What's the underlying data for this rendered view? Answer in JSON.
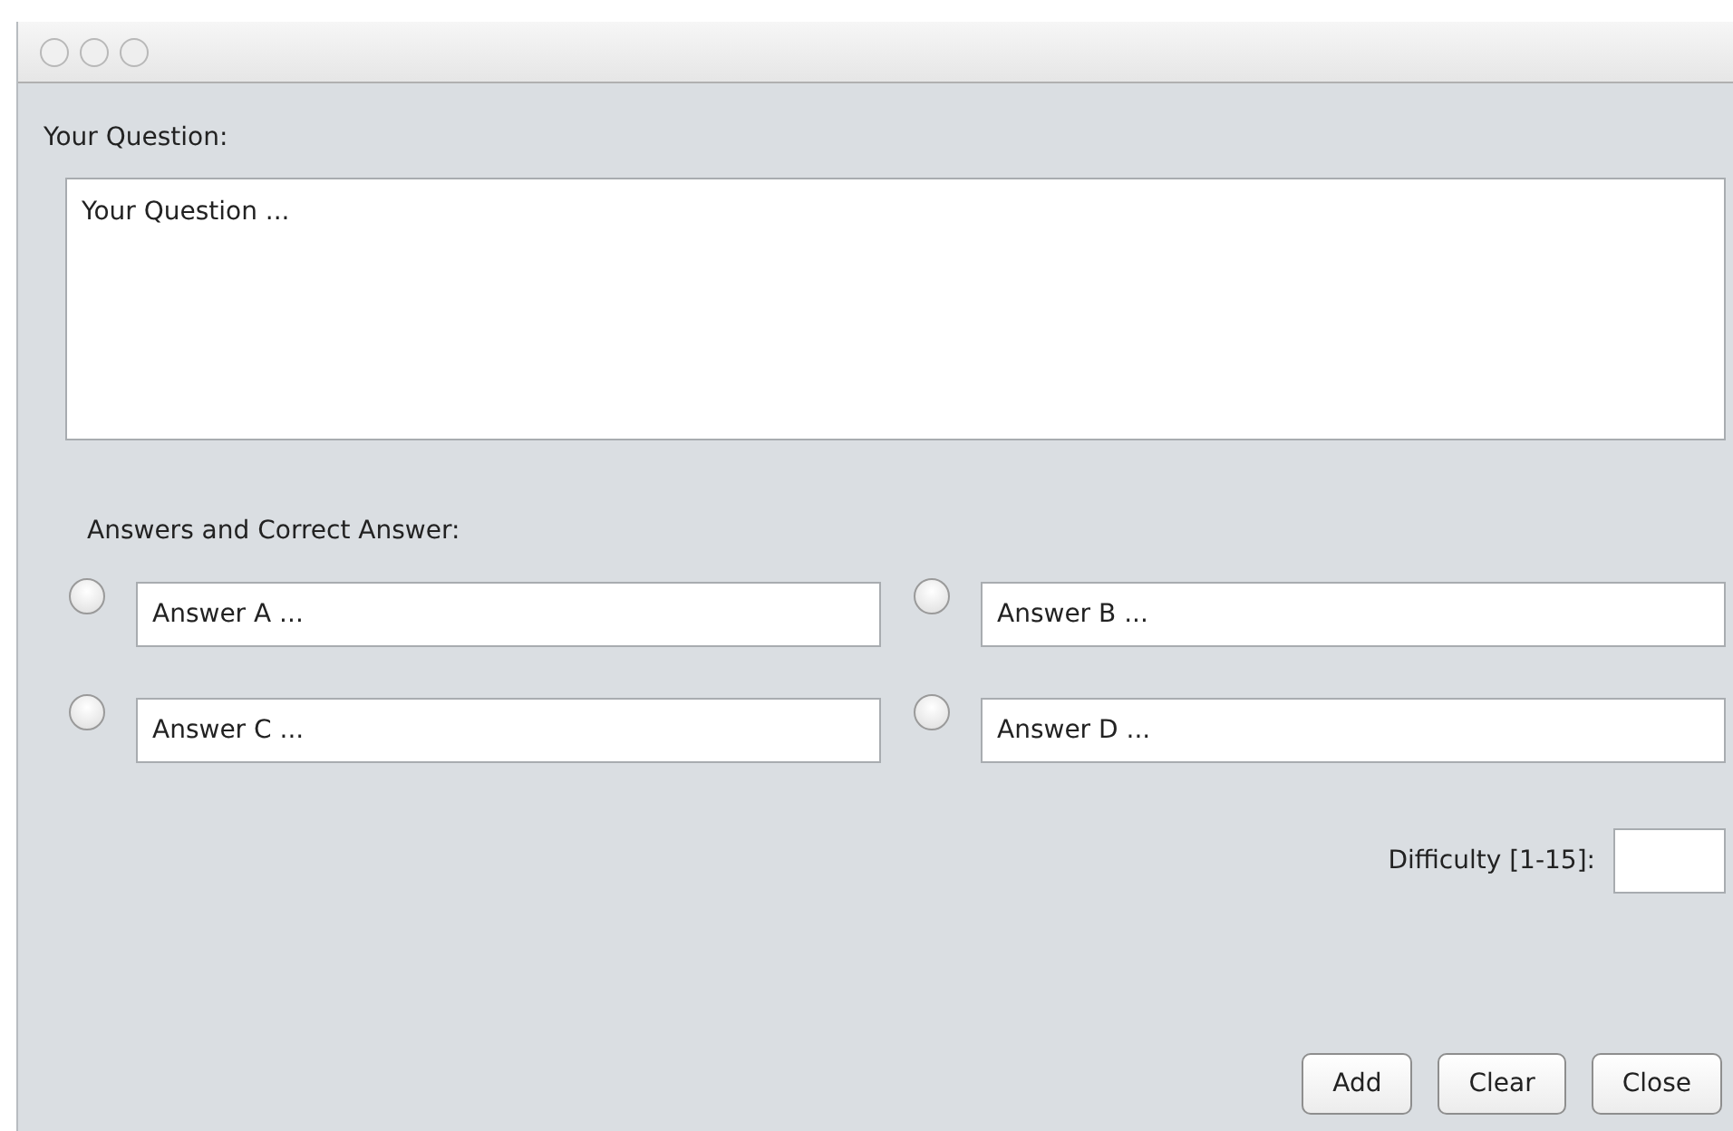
{
  "question": {
    "label": "Your Question:",
    "value": "Your Question ..."
  },
  "answers": {
    "label": "Answers and Correct Answer:",
    "items": [
      {
        "value": "Answer A ...",
        "selected": false
      },
      {
        "value": "Answer B ...",
        "selected": false
      },
      {
        "value": "Answer C ...",
        "selected": false
      },
      {
        "value": "Answer D ...",
        "selected": false
      }
    ]
  },
  "difficulty": {
    "label": "Difficulty [1-15]:"
  },
  "buttons": [
    "Add",
    "Clear",
    "Close"
  ]
}
